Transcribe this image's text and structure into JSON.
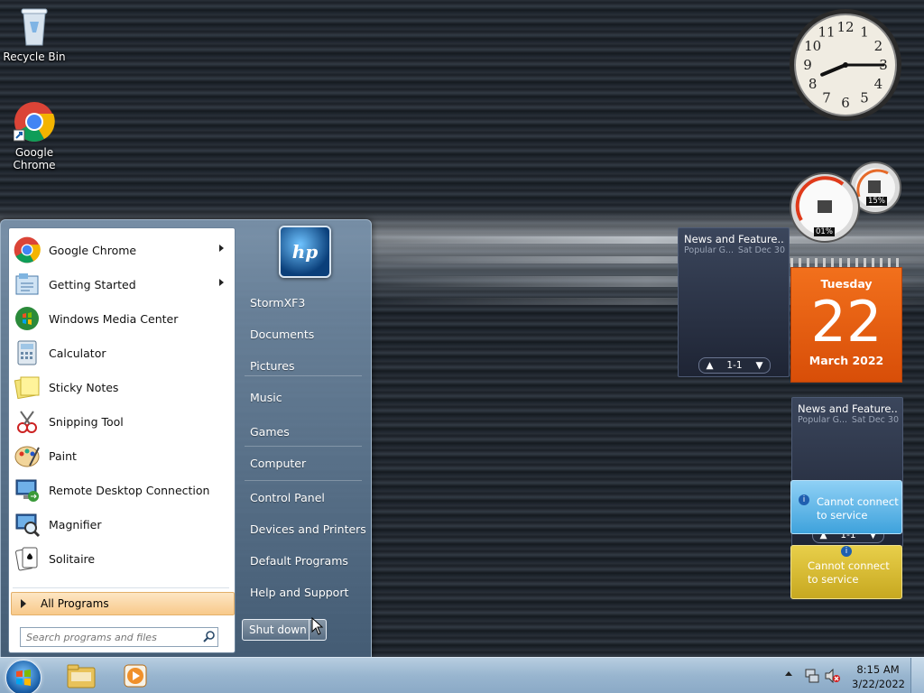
{
  "desktop": {
    "icons": [
      {
        "label": "Recycle Bin",
        "icon": "recycle-bin-icon"
      },
      {
        "label": "Google Chrome",
        "icon": "chrome-icon"
      }
    ]
  },
  "start_menu": {
    "programs": [
      {
        "label": "Google Chrome",
        "icon": "chrome-icon",
        "has_submenu": true
      },
      {
        "label": "Getting Started",
        "icon": "getting-started-icon",
        "has_submenu": true
      },
      {
        "label": "Windows Media Center",
        "icon": "media-center-icon",
        "has_submenu": false
      },
      {
        "label": "Calculator",
        "icon": "calculator-icon",
        "has_submenu": false
      },
      {
        "label": "Sticky Notes",
        "icon": "sticky-notes-icon",
        "has_submenu": false
      },
      {
        "label": "Snipping Tool",
        "icon": "snipping-tool-icon",
        "has_submenu": false
      },
      {
        "label": "Paint",
        "icon": "paint-icon",
        "has_submenu": false
      },
      {
        "label": "Remote Desktop Connection",
        "icon": "remote-desktop-icon",
        "has_submenu": false
      },
      {
        "label": "Magnifier",
        "icon": "magnifier-icon",
        "has_submenu": false
      },
      {
        "label": "Solitaire",
        "icon": "solitaire-icon",
        "has_submenu": false
      }
    ],
    "all_programs_label": "All Programs",
    "search_placeholder": "Search programs and files",
    "logo_text": "hp",
    "right_links": [
      {
        "label": "StormXF3"
      },
      {
        "label": "Documents"
      },
      {
        "label": "Pictures"
      },
      {
        "label": "Music"
      },
      {
        "label": "Games"
      },
      {
        "label": "Computer"
      },
      {
        "label": "Control Panel"
      },
      {
        "label": "Devices and Printers"
      },
      {
        "label": "Default Programs"
      },
      {
        "label": "Help and Support"
      }
    ],
    "shutdown_label": "Shut down"
  },
  "gadgets": {
    "clock": {
      "numbers": [
        "12",
        "1",
        "2",
        "3",
        "4",
        "5",
        "6",
        "7",
        "8",
        "9",
        "10",
        "11"
      ],
      "hour": 8,
      "minute": 15
    },
    "cpu_meter": {
      "cpu": "01%",
      "memory": "15%"
    },
    "calendar": {
      "weekday": "Tuesday",
      "day": "22",
      "month_year": "March 2022"
    },
    "news_top": {
      "title": "News and Feature...",
      "source": "Popular G...",
      "date": "Sat Dec 30",
      "pager": "1-1"
    },
    "news_bottom": {
      "title": "News and Feature...",
      "source": "Popular G...",
      "date": "Sat Dec 30",
      "pager": "1-1"
    },
    "error_blue": {
      "line1": "Cannot connect",
      "line2": "to service"
    },
    "error_yellow": {
      "line1": "Cannot connect",
      "line2": "to service"
    }
  },
  "taskbar": {
    "pinned": [
      {
        "name": "explorer-icon"
      },
      {
        "name": "media-player-icon"
      }
    ],
    "time": "8:15 AM",
    "date": "3/22/2022",
    "tray_icons": [
      "show-hidden-icons",
      "network-icon",
      "volume-muted-icon"
    ]
  }
}
